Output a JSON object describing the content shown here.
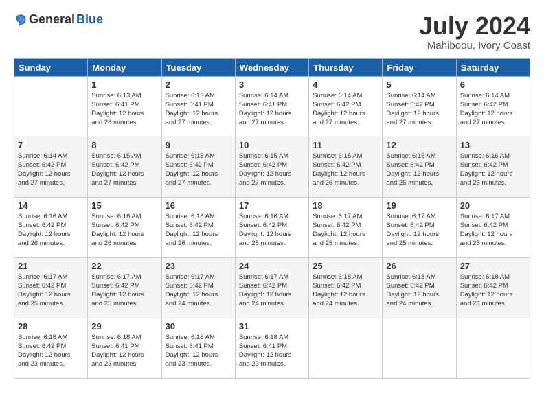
{
  "header": {
    "logo_general": "General",
    "logo_blue": "Blue",
    "title": "July 2024",
    "location": "Mahiboou, Ivory Coast"
  },
  "days_of_week": [
    "Sunday",
    "Monday",
    "Tuesday",
    "Wednesday",
    "Thursday",
    "Friday",
    "Saturday"
  ],
  "weeks": [
    [
      {
        "day": "",
        "info": ""
      },
      {
        "day": "1",
        "info": "Sunrise: 6:13 AM\nSunset: 6:41 PM\nDaylight: 12 hours\nand 28 minutes."
      },
      {
        "day": "2",
        "info": "Sunrise: 6:13 AM\nSunset: 6:41 PM\nDaylight: 12 hours\nand 27 minutes."
      },
      {
        "day": "3",
        "info": "Sunrise: 6:14 AM\nSunset: 6:41 PM\nDaylight: 12 hours\nand 27 minutes."
      },
      {
        "day": "4",
        "info": "Sunrise: 6:14 AM\nSunset: 6:42 PM\nDaylight: 12 hours\nand 27 minutes."
      },
      {
        "day": "5",
        "info": "Sunrise: 6:14 AM\nSunset: 6:42 PM\nDaylight: 12 hours\nand 27 minutes."
      },
      {
        "day": "6",
        "info": "Sunrise: 6:14 AM\nSunset: 6:42 PM\nDaylight: 12 hours\nand 27 minutes."
      }
    ],
    [
      {
        "day": "7",
        "info": "Sunrise: 6:14 AM\nSunset: 6:42 PM\nDaylight: 12 hours\nand 27 minutes."
      },
      {
        "day": "8",
        "info": "Sunrise: 6:15 AM\nSunset: 6:42 PM\nDaylight: 12 hours\nand 27 minutes."
      },
      {
        "day": "9",
        "info": "Sunrise: 6:15 AM\nSunset: 6:42 PM\nDaylight: 12 hours\nand 27 minutes."
      },
      {
        "day": "10",
        "info": "Sunrise: 6:15 AM\nSunset: 6:42 PM\nDaylight: 12 hours\nand 27 minutes."
      },
      {
        "day": "11",
        "info": "Sunrise: 6:15 AM\nSunset: 6:42 PM\nDaylight: 12 hours\nand 26 minutes."
      },
      {
        "day": "12",
        "info": "Sunrise: 6:15 AM\nSunset: 6:42 PM\nDaylight: 12 hours\nand 26 minutes."
      },
      {
        "day": "13",
        "info": "Sunrise: 6:16 AM\nSunset: 6:42 PM\nDaylight: 12 hours\nand 26 minutes."
      }
    ],
    [
      {
        "day": "14",
        "info": "Sunrise: 6:16 AM\nSunset: 6:42 PM\nDaylight: 12 hours\nand 26 minutes."
      },
      {
        "day": "15",
        "info": "Sunrise: 6:16 AM\nSunset: 6:42 PM\nDaylight: 12 hours\nand 26 minutes."
      },
      {
        "day": "16",
        "info": "Sunrise: 6:16 AM\nSunset: 6:42 PM\nDaylight: 12 hours\nand 26 minutes."
      },
      {
        "day": "17",
        "info": "Sunrise: 6:16 AM\nSunset: 6:42 PM\nDaylight: 12 hours\nand 25 minutes."
      },
      {
        "day": "18",
        "info": "Sunrise: 6:17 AM\nSunset: 6:42 PM\nDaylight: 12 hours\nand 25 minutes."
      },
      {
        "day": "19",
        "info": "Sunrise: 6:17 AM\nSunset: 6:42 PM\nDaylight: 12 hours\nand 25 minutes."
      },
      {
        "day": "20",
        "info": "Sunrise: 6:17 AM\nSunset: 6:42 PM\nDaylight: 12 hours\nand 25 minutes."
      }
    ],
    [
      {
        "day": "21",
        "info": "Sunrise: 6:17 AM\nSunset: 6:42 PM\nDaylight: 12 hours\nand 25 minutes."
      },
      {
        "day": "22",
        "info": "Sunrise: 6:17 AM\nSunset: 6:42 PM\nDaylight: 12 hours\nand 25 minutes."
      },
      {
        "day": "23",
        "info": "Sunrise: 6:17 AM\nSunset: 6:42 PM\nDaylight: 12 hours\nand 24 minutes."
      },
      {
        "day": "24",
        "info": "Sunrise: 6:17 AM\nSunset: 6:42 PM\nDaylight: 12 hours\nand 24 minutes."
      },
      {
        "day": "25",
        "info": "Sunrise: 6:18 AM\nSunset: 6:42 PM\nDaylight: 12 hours\nand 24 minutes."
      },
      {
        "day": "26",
        "info": "Sunrise: 6:18 AM\nSunset: 6:42 PM\nDaylight: 12 hours\nand 24 minutes."
      },
      {
        "day": "27",
        "info": "Sunrise: 6:18 AM\nSunset: 6:42 PM\nDaylight: 12 hours\nand 23 minutes."
      }
    ],
    [
      {
        "day": "28",
        "info": "Sunrise: 6:18 AM\nSunset: 6:42 PM\nDaylight: 12 hours\nand 23 minutes."
      },
      {
        "day": "29",
        "info": "Sunrise: 6:18 AM\nSunset: 6:41 PM\nDaylight: 12 hours\nand 23 minutes."
      },
      {
        "day": "30",
        "info": "Sunrise: 6:18 AM\nSunset: 6:41 PM\nDaylight: 12 hours\nand 23 minutes."
      },
      {
        "day": "31",
        "info": "Sunrise: 6:18 AM\nSunset: 6:41 PM\nDaylight: 12 hours\nand 23 minutes."
      },
      {
        "day": "",
        "info": ""
      },
      {
        "day": "",
        "info": ""
      },
      {
        "day": "",
        "info": ""
      }
    ]
  ]
}
